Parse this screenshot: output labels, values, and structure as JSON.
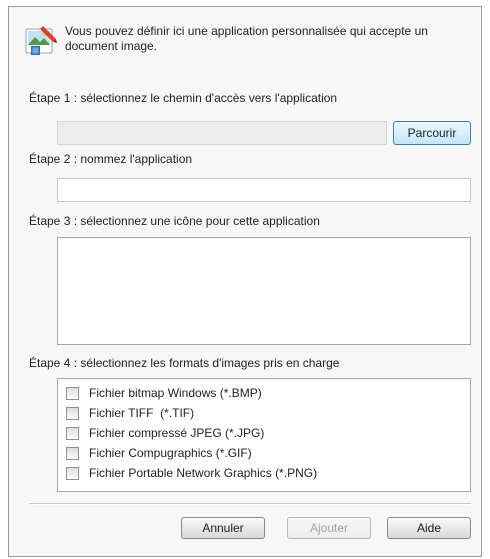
{
  "header": {
    "icon": "application-image-icon",
    "text": "Vous pouvez définir ici une application personnalisée qui accepte un document image."
  },
  "step1": {
    "label": "Étape 1 : sélectionnez le chemin d'accès vers l'application",
    "path_value": "",
    "browse_label": "Parcourir"
  },
  "step2": {
    "label": "Étape 2 : nommez l'application",
    "name_value": ""
  },
  "step3": {
    "label": "Étape 3 : sélectionnez une icône pour cette application"
  },
  "step4": {
    "label": "Étape 4 : sélectionnez les formats d'images pris en charge",
    "formats": [
      {
        "label": "Fichier bitmap Windows (*.BMP)",
        "checked": false
      },
      {
        "label": "Fichier TIFF  (*.TIF)",
        "checked": false
      },
      {
        "label": "Fichier compressé JPEG (*.JPG)",
        "checked": false
      },
      {
        "label": "Fichier Compugraphics (*.GIF)",
        "checked": false
      },
      {
        "label": "Fichier Portable Network Graphics (*.PNG)",
        "checked": false
      }
    ]
  },
  "footer": {
    "cancel_label": "Annuler",
    "add_label": "Ajouter",
    "help_label": "Aide"
  }
}
